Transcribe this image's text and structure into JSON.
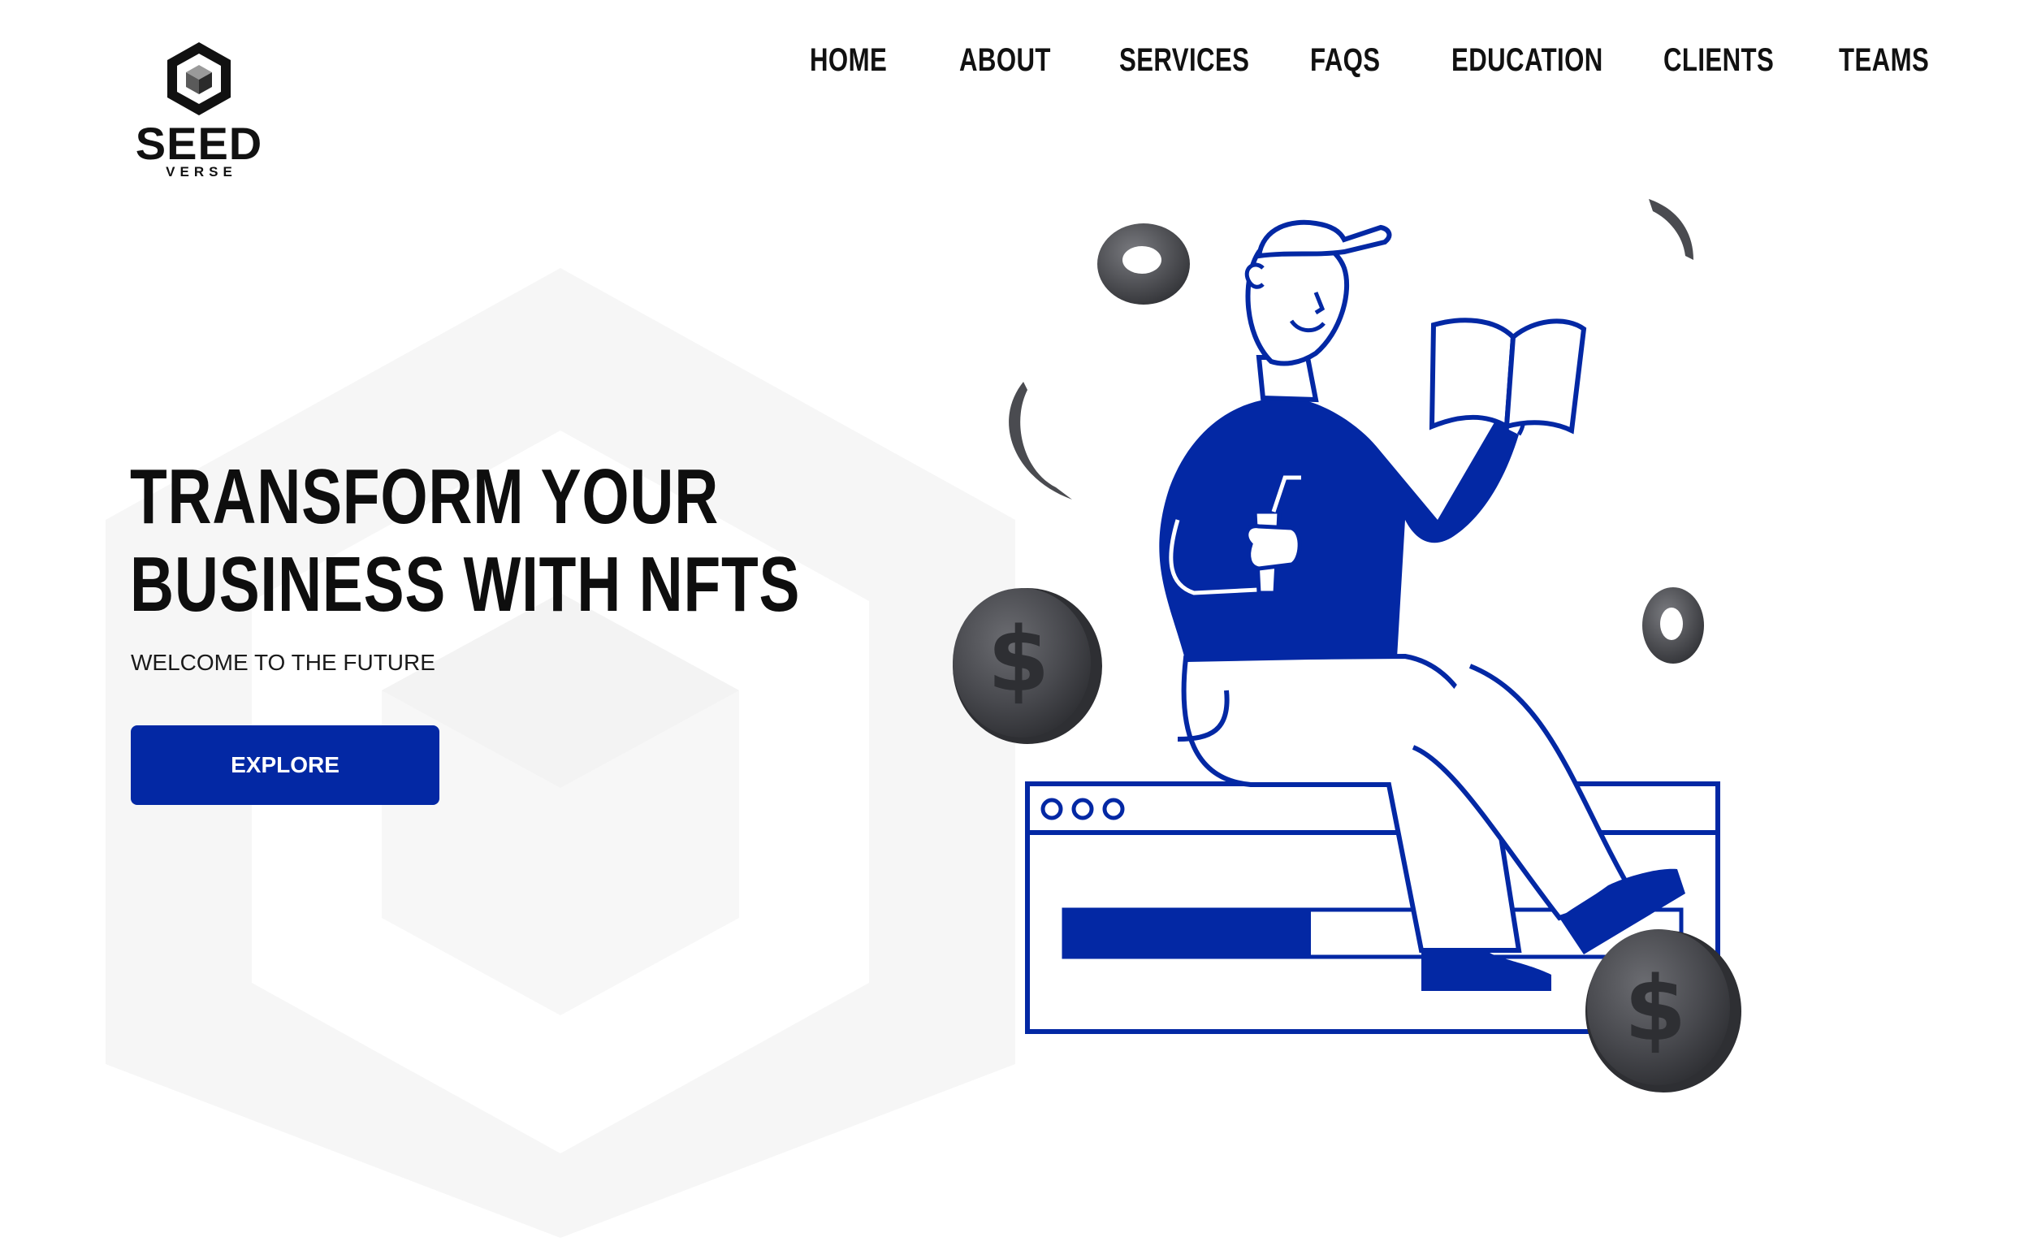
{
  "brand": {
    "name": "SEED",
    "sub": "VERSE"
  },
  "nav": {
    "items": [
      {
        "label": "HOME"
      },
      {
        "label": "ABOUT"
      },
      {
        "label": "SERVICES"
      },
      {
        "label": "FAQS"
      },
      {
        "label": "EDUCATION"
      },
      {
        "label": "CLIENTS"
      },
      {
        "label": "TEAMS"
      }
    ]
  },
  "hero": {
    "title_line1": "TRANSFORM YOUR",
    "title_line2": "BUSINESS WITH NFTS",
    "subtitle": "WELCOME TO THE FUTURE",
    "cta_label": "EXPLORE"
  },
  "illustration": {
    "progress": 0.4,
    "coin_symbol": "$"
  },
  "colors": {
    "accent": "#0328a4",
    "text": "#111111",
    "coin": "#4a4b50",
    "hex_bg": "#f6f6f6"
  }
}
